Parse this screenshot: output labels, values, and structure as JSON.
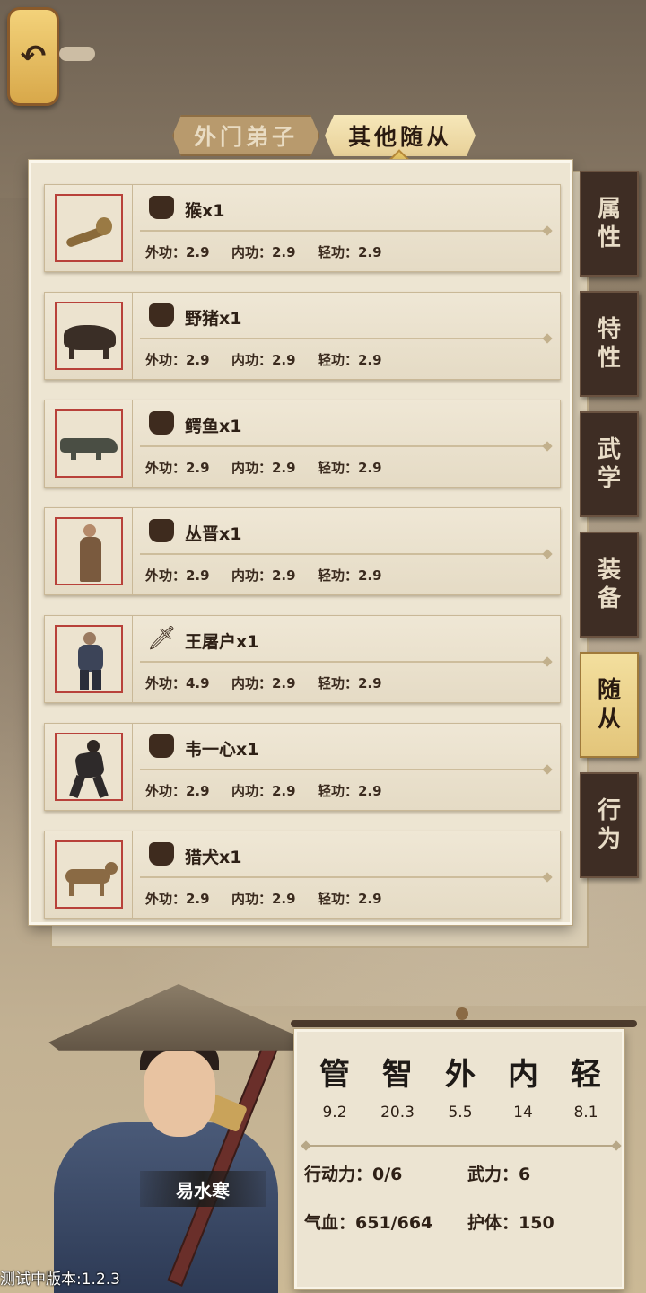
{
  "tabs": {
    "outer_disciples": "外门弟子",
    "other_followers": "其他随从"
  },
  "followers": [
    {
      "name": "猴x1",
      "weapon": "fist-icon",
      "stats": [
        "外功：2.9",
        "内功：2.9",
        "轻功：2.9"
      ]
    },
    {
      "name": "野猪x1",
      "weapon": "fist-icon",
      "stats": [
        "外功：2.9",
        "内功：2.9",
        "轻功：2.9"
      ]
    },
    {
      "name": "鳄鱼x1",
      "weapon": "fist-icon",
      "stats": [
        "外功：2.9",
        "内功：2.9",
        "轻功：2.9"
      ]
    },
    {
      "name": "丛晋x1",
      "weapon": "fist-icon",
      "stats": [
        "外功：2.9",
        "内功：2.9",
        "轻功：2.9"
      ]
    },
    {
      "name": "王屠户x1",
      "weapon": "blade-icon",
      "stats": [
        "外功：4.9",
        "内功：2.9",
        "轻功：2.9"
      ]
    },
    {
      "name": "韦一心x1",
      "weapon": "fist-icon",
      "stats": [
        "外功：2.9",
        "内功：2.9",
        "轻功：2.9"
      ]
    },
    {
      "name": "猎犬x1",
      "weapon": "fist-icon",
      "stats": [
        "外功：2.9",
        "内功：2.9",
        "轻功：2.9"
      ]
    }
  ],
  "side_tabs": [
    {
      "chars": [
        "属",
        "性"
      ]
    },
    {
      "chars": [
        "特",
        "性"
      ]
    },
    {
      "chars": [
        "武",
        "学"
      ]
    },
    {
      "chars": [
        "装",
        "备"
      ]
    },
    {
      "chars": [
        "随",
        "从"
      ],
      "active": true
    },
    {
      "chars": [
        "行",
        "为"
      ]
    }
  ],
  "character": {
    "name": "易水寒"
  },
  "attributes": [
    {
      "label": "管",
      "value": "9.2"
    },
    {
      "label": "智",
      "value": "20.3"
    },
    {
      "label": "外",
      "value": "5.5"
    },
    {
      "label": "内",
      "value": "14"
    },
    {
      "label": "轻",
      "value": "8.1"
    }
  ],
  "status": {
    "action_points": "行动力：0/6",
    "force": "武力：6",
    "hp": "气血：651/664",
    "armor": "护体：150"
  },
  "version": "测试中版本:1.2.3",
  "icons": {
    "back": "back-arrow-icon"
  }
}
